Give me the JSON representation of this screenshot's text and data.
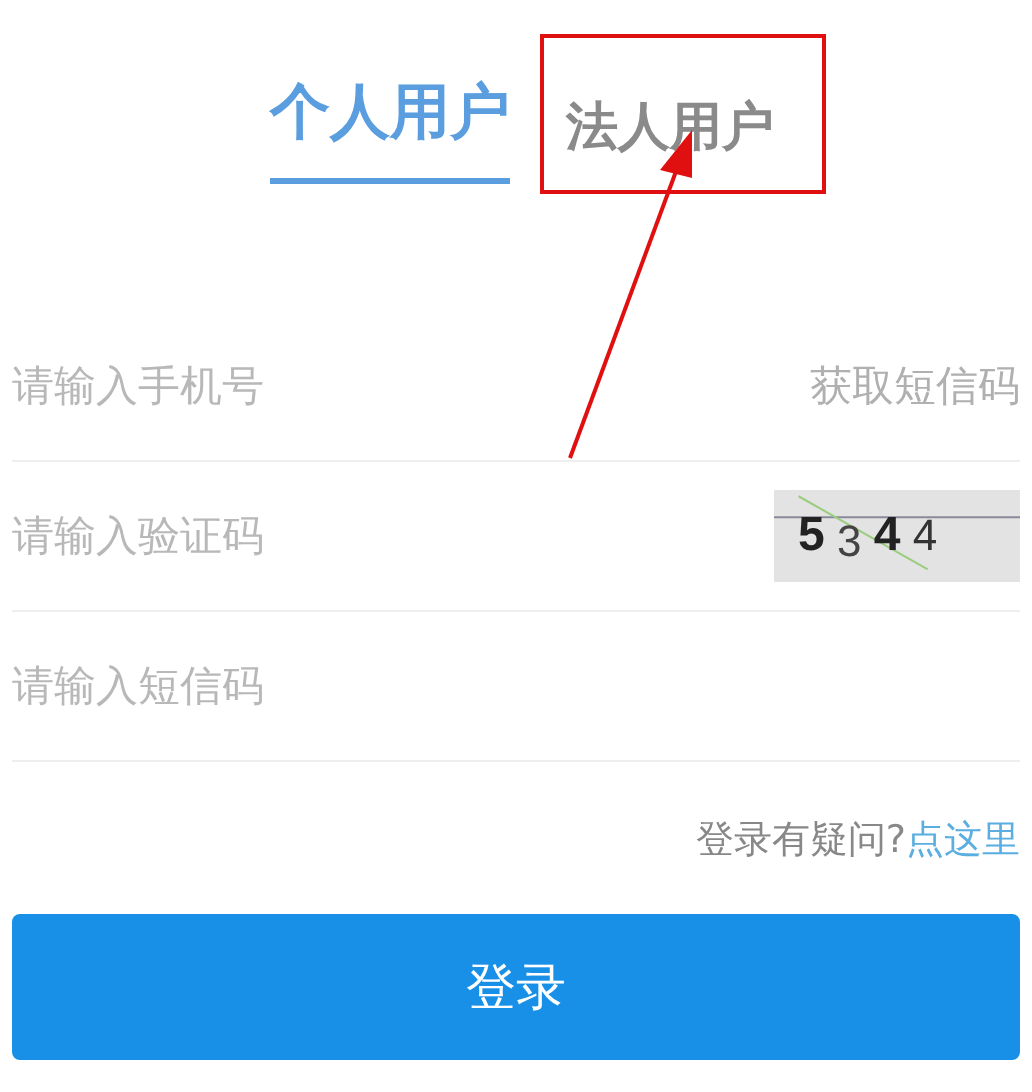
{
  "tabs": [
    {
      "label": "个人用户",
      "selected": true
    },
    {
      "label": "法人用户",
      "selected": false
    }
  ],
  "fields": [
    {
      "kind": "sms",
      "placeholder": "请输入手机号",
      "action": "获取短信码"
    },
    {
      "kind": "captcha",
      "placeholder": "请输入验证码",
      "captcha": "5 3 4 4"
    },
    {
      "kind": "plain",
      "placeholder": "请输入短信码"
    }
  ],
  "help": {
    "text": "登录有疑问?",
    "link": "点这里"
  },
  "login_button": "登录"
}
